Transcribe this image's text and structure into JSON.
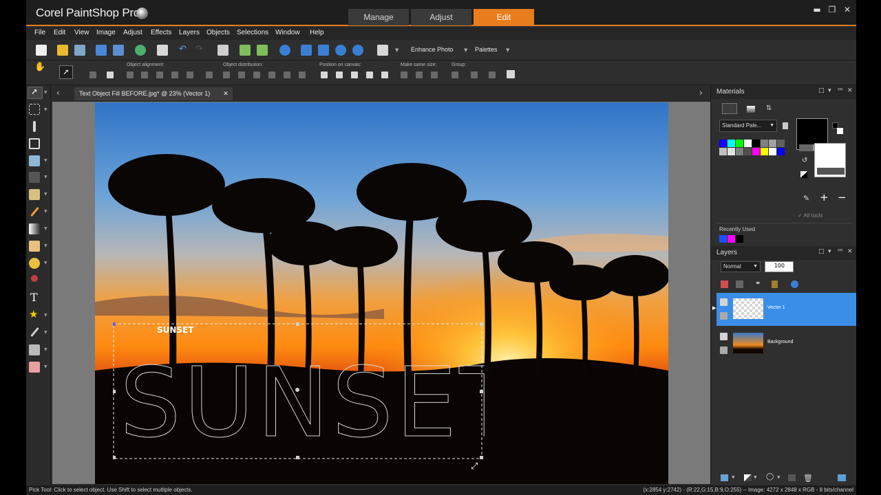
{
  "app": {
    "title": "Corel PaintShop Pro",
    "modes": [
      "Manage",
      "Adjust",
      "Edit"
    ],
    "active_mode": "Edit",
    "window_controls": [
      "minimize",
      "restore",
      "close"
    ]
  },
  "menu": [
    "File",
    "Edit",
    "View",
    "Image",
    "Adjust",
    "Effects",
    "Layers",
    "Objects",
    "Selections",
    "Window",
    "Help"
  ],
  "toolbar": {
    "enhance_photo": "Enhance Photo",
    "palettes": "Palettes"
  },
  "tool_options": {
    "object_alignment": "Object alignment:",
    "object_distribution": "Object distribution:",
    "position_on_canvas": "Position on canvas:",
    "make_same_size": "Make same size:",
    "group": "Group:"
  },
  "document": {
    "tab_title": "Text Object Fill BEFORE.jpg*  @  23% (Vector 1)",
    "overlay_text_small": "SUNSET",
    "overlay_text_large": "SUNSET"
  },
  "materials": {
    "title": "Materials",
    "palette_select": "Standard Pale...",
    "all_tools": "All tools",
    "recently_used": "Recently Used",
    "foreground_color": "#000000",
    "background_color": "#ffffff",
    "swatches": [
      "#0000ff",
      "#00ffff",
      "#00ff00",
      "#ffffff",
      "#000000",
      "#808080",
      "#a0a0a0",
      "#606060",
      "#c0c0c0",
      "#e0e0e0",
      "#808080",
      "#505050",
      "#ff00ff",
      "#ffff00",
      "#ffffff",
      "#0000ff"
    ],
    "recent_colors": [
      "#1e50ff",
      "#ff00ff",
      "#000000"
    ]
  },
  "layers": {
    "title": "Layers",
    "blend_mode": "Normal",
    "opacity": "100",
    "items": [
      {
        "name": "Vector 1",
        "selected": true
      },
      {
        "name": "Background",
        "selected": false
      }
    ]
  },
  "status": {
    "left": "Pick Tool: Click to select object. Use Shift to select multiple objects.",
    "right": "(x:2854 y:2742) - (R:22,G:15,B:9,O:255) -- Image:  4272 x 2848 x RGB - 8 bits/channel"
  }
}
